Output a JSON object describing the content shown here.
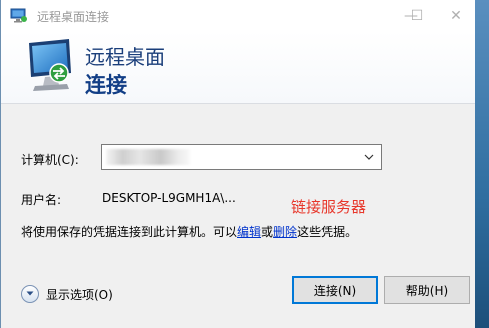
{
  "window": {
    "title": "远程桌面连接",
    "min_glyph": "—",
    "max_glyph": "☐",
    "close_glyph": "✕"
  },
  "banner": {
    "line1": "远程桌面",
    "line2": "连接"
  },
  "form": {
    "computer_label": "计算机(C):",
    "computer_value": "",
    "username_label": "用户名:",
    "username_value": "DESKTOP-L9GMH1A\\...",
    "annotation": "链接服务器",
    "credentials_prefix": "将使用保存的凭据连接到此计算机。可以",
    "credentials_edit_link": "编辑",
    "credentials_or": "或",
    "credentials_delete_link": "删除",
    "credentials_suffix": "这些凭据。"
  },
  "footer": {
    "show_options_label": "显示选项(O)",
    "connect_button": "连接(N)",
    "help_button": "帮助(H)"
  },
  "colors": {
    "title_text": "#999999",
    "banner_text": "#123e86",
    "annotation": "#e8372b",
    "link": "#0033cc",
    "default_button_border": "#0078d7"
  },
  "icons": {
    "app": "remote-desktop-icon",
    "options_toggle": "chevron-down-circle-icon",
    "combo": "chevron-down-icon"
  }
}
